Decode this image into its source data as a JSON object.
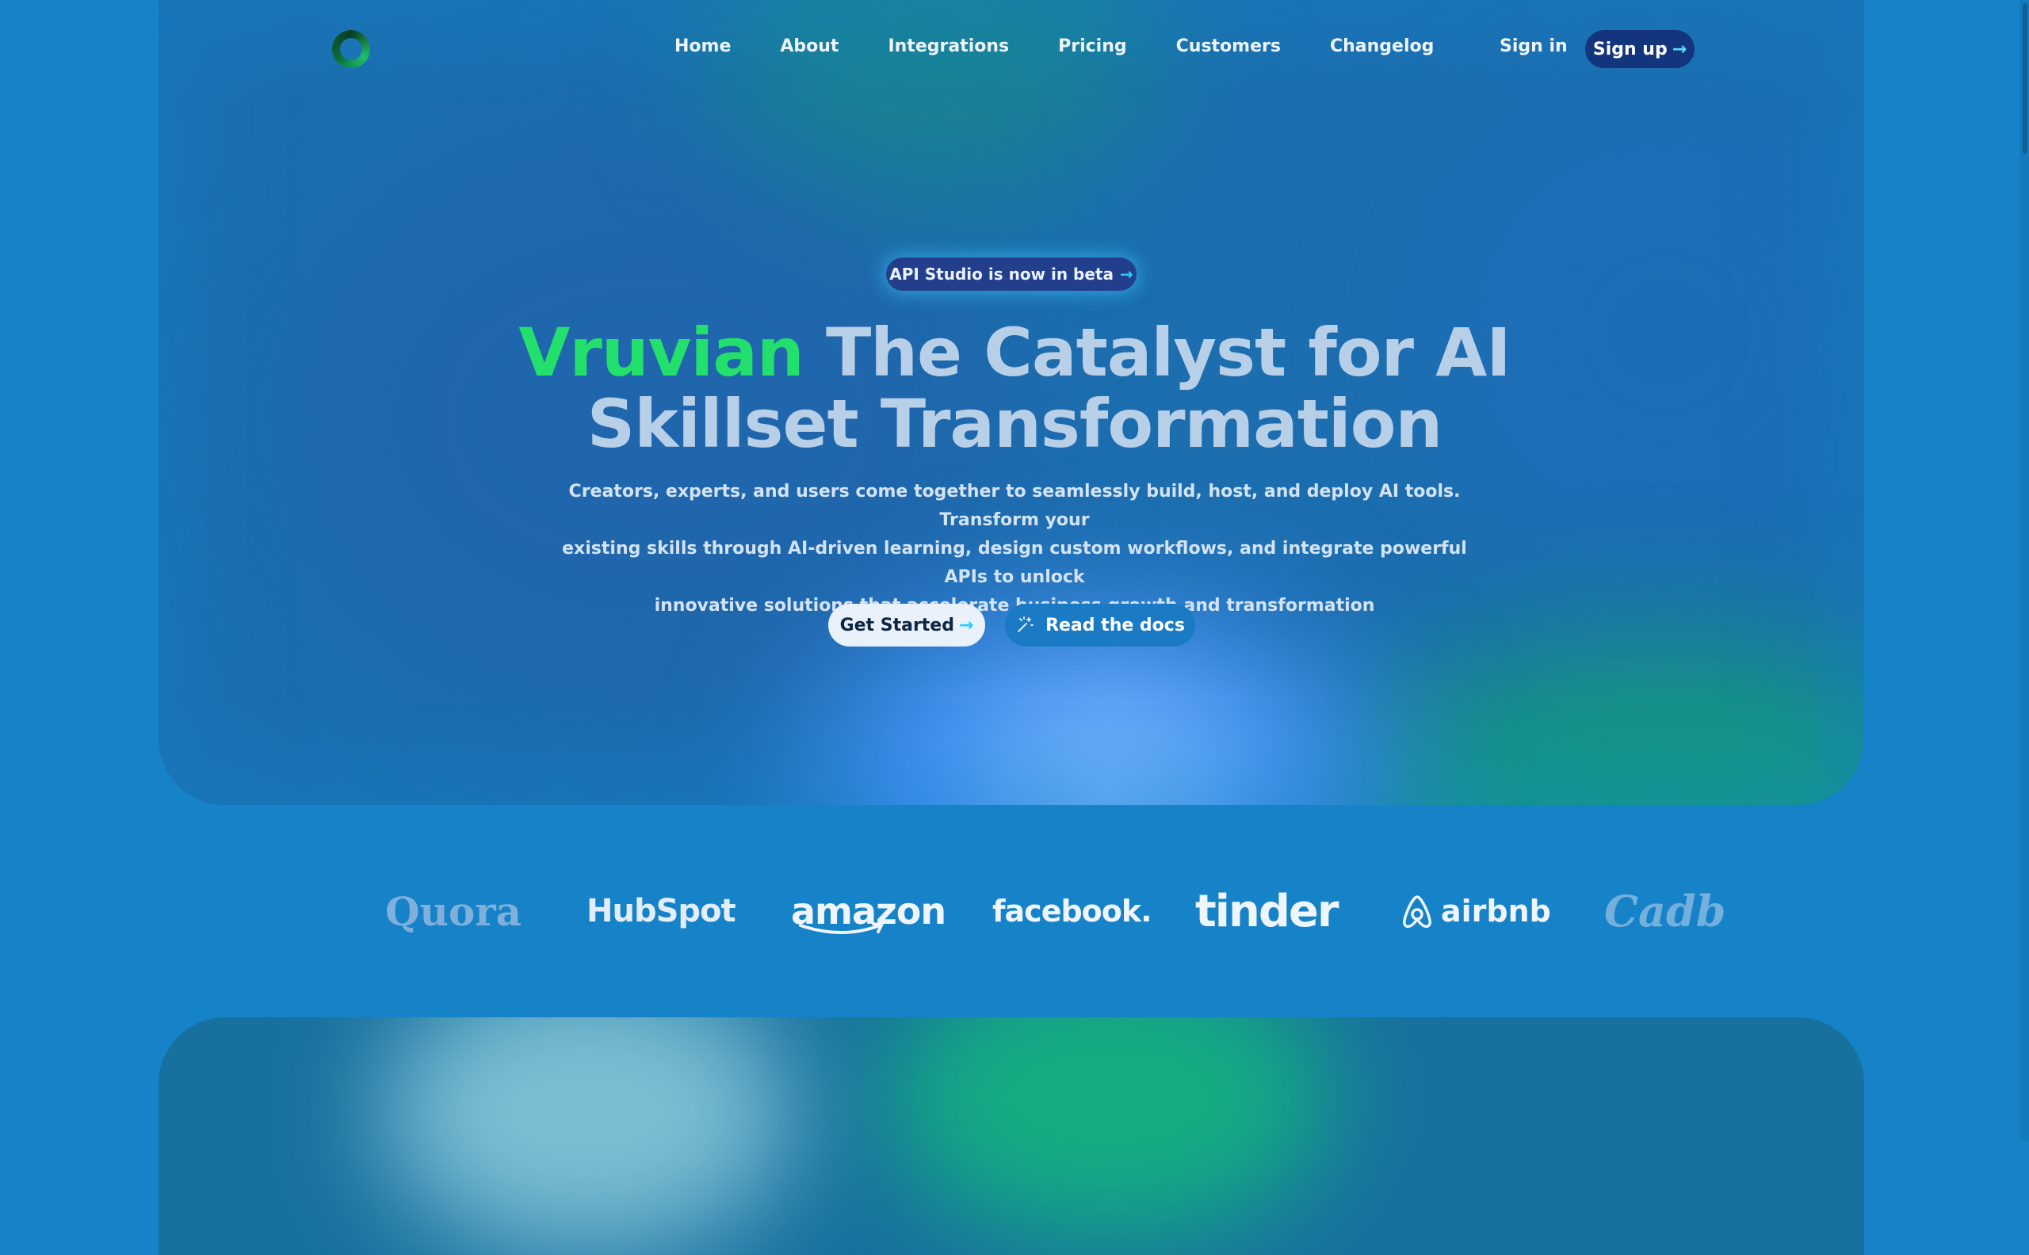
{
  "nav": {
    "links": [
      "Home",
      "About",
      "Integrations",
      "Pricing",
      "Customers",
      "Changelog"
    ],
    "sign_in": "Sign in",
    "sign_up": "Sign up"
  },
  "hero": {
    "badge": "API Studio is now in beta",
    "brand": "Vruvian",
    "title_line1": "The Catalyst for AI",
    "title_line2": "Skillset Transformation",
    "subtitle_line1": "Creators, experts, and users come together to seamlessly build, host, and deploy AI tools. Transform your",
    "subtitle_line2": "existing skills through AI-driven learning, design custom workflows, and integrate powerful APIs to unlock",
    "subtitle_line3": "innovative solutions that accelerate business growth and transformation",
    "cta_primary": "Get Started",
    "cta_secondary": "Read the docs"
  },
  "arrow_glyph": "→",
  "customers": {
    "logos": [
      "Quora",
      "HubSpot",
      "amazon",
      "facebook",
      "tinder",
      "airbnb",
      "Cadbury"
    ],
    "logo_texts": [
      "Quora",
      "HubSpot",
      "amazon",
      "facebook.",
      "tinder",
      "airbnb",
      "Cadb"
    ]
  },
  "colors": {
    "background": "#1682c7",
    "brand_green": "#22e06b",
    "accent_arrow": "#25d0ff",
    "sign_up_bg": "#12357e"
  },
  "icons": [
    "logo-ring",
    "arrow-right-icon",
    "magic-wand-icon",
    "airbnb-belo-icon"
  ]
}
